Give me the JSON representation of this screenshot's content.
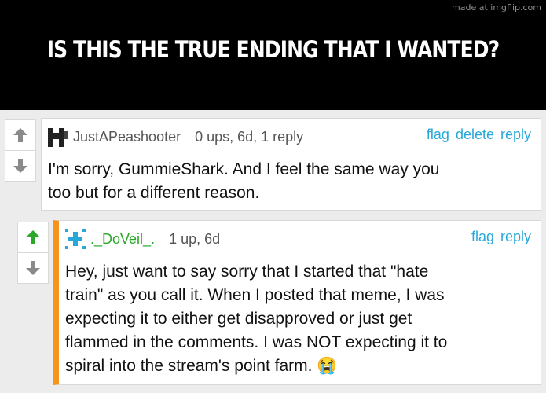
{
  "watermark": "made at imgflip.com",
  "caption": "IS THIS THE TRUE ENDING THAT I WANTED?",
  "comments": [
    {
      "username": "JustAPeashooter",
      "meta": "0 ups, 6d, 1 reply",
      "actions": [
        "flag",
        "delete",
        "reply"
      ],
      "text_lines": [
        "I'm sorry, GummieShark. And I feel the same way you",
        "too but for a different reason."
      ],
      "upvoted": false
    },
    {
      "username": "._DoVeil_.",
      "meta": "1 up, 6d",
      "actions": [
        "flag",
        "reply"
      ],
      "text_lines": [
        "Hey, just want to say sorry that I started that \"hate",
        "train\" as you call it. When I posted that meme, I was",
        "expecting it to either get disapproved or just get",
        "flammed in the comments. I was NOT expecting it to",
        "spiral into the stream's point farm. 😭"
      ],
      "upvoted": true
    }
  ],
  "colors": {
    "link": "#28a8d8",
    "upvote_active": "#2aa82a",
    "reply_border": "#f7941d"
  }
}
